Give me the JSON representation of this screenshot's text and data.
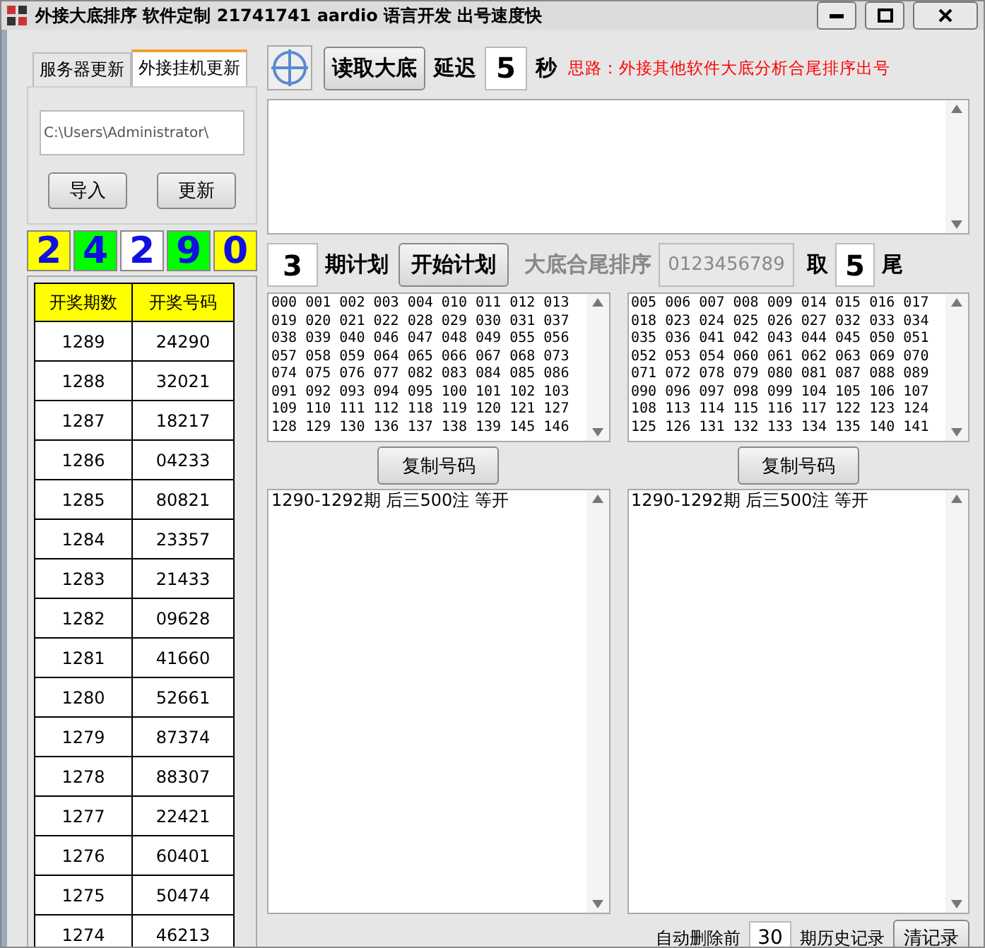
{
  "window": {
    "title": "外接大底排序 软件定制 21741741 aardio 语言开发 出号速度快"
  },
  "tabs": [
    {
      "label": "服务器更新",
      "selected": false
    },
    {
      "label": "外接挂机更新",
      "selected": true
    }
  ],
  "path_field": {
    "value": "C:\\Users\\Administrator\\"
  },
  "left_buttons": [
    "导入",
    "更新"
  ],
  "digits": [
    {
      "value": "2",
      "color": "#ffff00"
    },
    {
      "value": "4",
      "color": "#00ff00"
    },
    {
      "value": "2",
      "color": "#ffffff"
    },
    {
      "value": "9",
      "color": "#00ff00"
    },
    {
      "value": "0",
      "color": "#ffff00"
    }
  ],
  "table": {
    "columns": [
      "开奖期数",
      "开奖号码"
    ],
    "rows": [
      [
        "1289",
        "24290"
      ],
      [
        "1288",
        "32021"
      ],
      [
        "1287",
        "18217"
      ],
      [
        "1286",
        "04233"
      ],
      [
        "1285",
        "80821"
      ],
      [
        "1284",
        "23357"
      ],
      [
        "1283",
        "21433"
      ],
      [
        "1282",
        "09628"
      ],
      [
        "1281",
        "41660"
      ],
      [
        "1280",
        "52661"
      ],
      [
        "1279",
        "87374"
      ],
      [
        "1278",
        "88307"
      ],
      [
        "1277",
        "22421"
      ],
      [
        "1276",
        "60401"
      ],
      [
        "1275",
        "50474"
      ],
      [
        "1274",
        "46213"
      ]
    ]
  },
  "toolbar": {
    "read_button": "读取大底",
    "delay_label": "延迟",
    "delay_value": "5",
    "delay_unit": "秒",
    "hint": "思路：外接其他软件大底分析合尾排序出号"
  },
  "plan": {
    "periods_value": "3",
    "periods_label": "期计划",
    "start_button": "开始计划",
    "sort_label": "大底合尾排序",
    "sort_value": "0123456789",
    "take_label": "取",
    "take_value": "5",
    "take_unit": "尾"
  },
  "number_lists": [
    {
      "lines": [
        "000 001 002 003 004 010 011 012 013",
        "019 020 021 022 028 029 030 031 037",
        "038 039 040 046 047 048 049 055 056",
        "057 058 059 064 065 066 067 068 073",
        "074 075 076 077 082 083 084 085 086",
        "091 092 093 094 095 100 101 102 103",
        "109 110 111 112 118 119 120 121 127",
        "128 129 130 136 137 138 139 145 146"
      ],
      "copy_button": "复制号码",
      "result": "1290-1292期 后三500注 等开"
    },
    {
      "lines": [
        "005 006 007 008 009 014 015 016 017",
        "018 023 024 025 026 027 032 033 034",
        "035 036 041 042 043 044 045 050 051",
        "052 053 054 060 061 062 063 069 070",
        "071 072 078 079 080 081 087 088 089",
        "090 096 097 098 099 104 105 106 107",
        "108 113 114 115 116 117 122 123 124",
        "125 126 131 132 133 134 135 140 141"
      ],
      "copy_button": "复制号码",
      "result": "1290-1292期 后三500注 等开"
    }
  ],
  "footer": {
    "prefix": "自动删除前",
    "value": "30",
    "suffix": "期历史记录",
    "clear_button": "清记录"
  }
}
